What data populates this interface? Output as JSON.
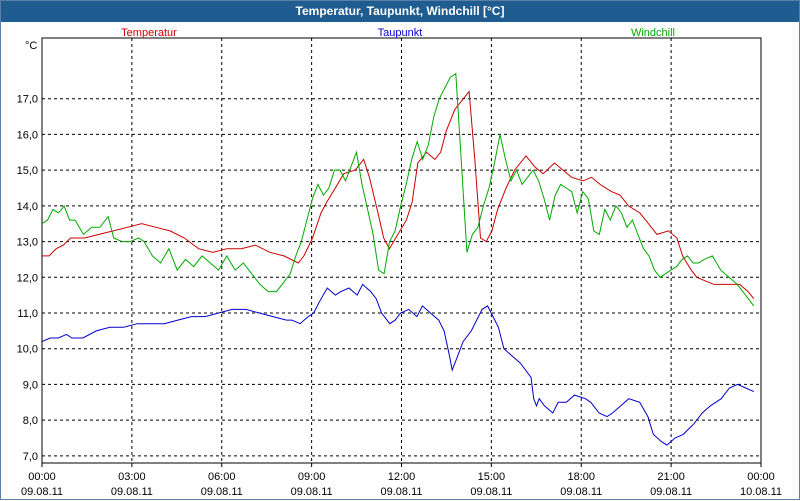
{
  "window": {
    "title": "Temperatur, Taupunkt, Windchill [°C]"
  },
  "chart_data": {
    "type": "line",
    "title": "Temperatur, Taupunkt, Windchill [°C]",
    "ylabel": "°C",
    "ylim": [
      6.8,
      18.7
    ],
    "yticks": [
      7.0,
      8.0,
      9.0,
      10.0,
      11.0,
      12.0,
      13.0,
      14.0,
      15.0,
      16.0,
      17.0
    ],
    "ytick_labels": [
      "7,0",
      "8,0",
      "9,0",
      "10,0",
      "11,0",
      "12,0",
      "13,0",
      "14,0",
      "15,0",
      "16,0",
      "17,0"
    ],
    "xlim": [
      0,
      24
    ],
    "xticks": [
      0,
      3,
      6,
      9,
      12,
      15,
      18,
      21,
      24
    ],
    "xtick_time_labels": [
      "00:00",
      "03:00",
      "06:00",
      "09:00",
      "12:00",
      "15:00",
      "18:00",
      "21:00",
      "00:00"
    ],
    "xtick_date_labels": [
      "09.08.11",
      "09.08.11",
      "09.08.11",
      "09.08.11",
      "09.08.11",
      "09.08.11",
      "09.08.11",
      "09.08.11",
      "10.08.11"
    ],
    "grid": true,
    "legend_placement": "top",
    "series": [
      {
        "name": "Temperatur",
        "color": "#cc0000",
        "points": [
          [
            0,
            12.6
          ],
          [
            0.25,
            12.6
          ],
          [
            0.5,
            12.8
          ],
          [
            0.75,
            12.9
          ],
          [
            1,
            13.1
          ],
          [
            1.5,
            13.1
          ],
          [
            2,
            13.2
          ],
          [
            2.5,
            13.3
          ],
          [
            3,
            13.4
          ],
          [
            3.5,
            13.5
          ],
          [
            4,
            13.4
          ],
          [
            4.5,
            13.3
          ],
          [
            5,
            13.1
          ],
          [
            5.5,
            12.8
          ],
          [
            6,
            12.7
          ],
          [
            6.5,
            12.8
          ],
          [
            7,
            12.8
          ],
          [
            7.5,
            12.9
          ],
          [
            8,
            12.7
          ],
          [
            8.5,
            12.6
          ],
          [
            9,
            12.4
          ],
          [
            9.2,
            12.6
          ],
          [
            9.5,
            13.1
          ],
          [
            9.8,
            13.8
          ],
          [
            10,
            14.1
          ],
          [
            10.3,
            14.5
          ],
          [
            10.6,
            14.9
          ],
          [
            11,
            15.0
          ],
          [
            11.3,
            15.3
          ],
          [
            11.5,
            14.8
          ],
          [
            11.8,
            13.8
          ],
          [
            12,
            13.1
          ],
          [
            12.2,
            12.8
          ],
          [
            12.5,
            13.2
          ],
          [
            12.8,
            13.6
          ],
          [
            13,
            14.1
          ],
          [
            13.2,
            15.2
          ],
          [
            13.5,
            15.5
          ],
          [
            13.8,
            15.3
          ],
          [
            14,
            15.5
          ],
          [
            14.2,
            16.1
          ],
          [
            14.5,
            16.7
          ],
          [
            14.8,
            17.0
          ],
          [
            15,
            17.2
          ],
          [
            15.2,
            15.3
          ],
          [
            15.4,
            13.1
          ],
          [
            15.6,
            13.0
          ],
          [
            15.8,
            13.3
          ],
          [
            16,
            13.9
          ],
          [
            16.3,
            14.5
          ],
          [
            16.6,
            15.0
          ],
          [
            17,
            15.4
          ],
          [
            17.3,
            15.1
          ],
          [
            17.6,
            14.9
          ],
          [
            18,
            15.2
          ],
          [
            18.3,
            15.0
          ],
          [
            18.6,
            14.8
          ],
          [
            19,
            14.7
          ],
          [
            19.3,
            14.8
          ],
          [
            19.6,
            14.6
          ],
          [
            20,
            14.4
          ],
          [
            20.3,
            14.3
          ],
          [
            20.6,
            14.0
          ],
          [
            21,
            13.8
          ],
          [
            21.3,
            13.5
          ],
          [
            21.6,
            13.2
          ],
          [
            22,
            13.3
          ],
          [
            22.3,
            13.1
          ],
          [
            22.5,
            12.6
          ],
          [
            22.8,
            12.2
          ],
          [
            23,
            12.0
          ],
          [
            23.3,
            11.9
          ],
          [
            23.6,
            11.8
          ],
          [
            24,
            11.8
          ],
          [
            24.5,
            11.8
          ],
          [
            24.8,
            11.6
          ],
          [
            25,
            11.4
          ]
        ]
      },
      {
        "name": "Taupunkt",
        "color": "#0000cc",
        "points": [
          [
            0,
            10.2
          ],
          [
            0.3,
            10.3
          ],
          [
            0.6,
            10.3
          ],
          [
            0.9,
            10.4
          ],
          [
            1.1,
            10.3
          ],
          [
            1.5,
            10.3
          ],
          [
            2,
            10.5
          ],
          [
            2.5,
            10.6
          ],
          [
            3,
            10.6
          ],
          [
            3.5,
            10.7
          ],
          [
            4,
            10.7
          ],
          [
            4.5,
            10.7
          ],
          [
            5,
            10.8
          ],
          [
            5.5,
            10.9
          ],
          [
            6,
            10.9
          ],
          [
            6.5,
            11.0
          ],
          [
            7,
            11.1
          ],
          [
            7.5,
            11.1
          ],
          [
            8,
            11.0
          ],
          [
            8.5,
            10.9
          ],
          [
            9,
            10.8
          ],
          [
            9.2,
            10.8
          ],
          [
            9.5,
            10.7
          ],
          [
            9.8,
            10.9
          ],
          [
            10,
            11.0
          ],
          [
            10.2,
            11.3
          ],
          [
            10.5,
            11.7
          ],
          [
            10.8,
            11.5
          ],
          [
            11,
            11.6
          ],
          [
            11.3,
            11.7
          ],
          [
            11.6,
            11.5
          ],
          [
            11.8,
            11.8
          ],
          [
            12.1,
            11.6
          ],
          [
            12.3,
            11.4
          ],
          [
            12.5,
            11.0
          ],
          [
            12.8,
            10.7
          ],
          [
            13,
            10.8
          ],
          [
            13.2,
            11.0
          ],
          [
            13.5,
            11.1
          ],
          [
            13.8,
            10.9
          ],
          [
            14,
            11.2
          ],
          [
            14.3,
            11.0
          ],
          [
            14.6,
            10.8
          ],
          [
            14.8,
            10.5
          ],
          [
            15,
            9.8
          ],
          [
            15.1,
            9.4
          ],
          [
            15.3,
            9.8
          ],
          [
            15.5,
            10.2
          ],
          [
            15.8,
            10.5
          ],
          [
            16,
            10.8
          ],
          [
            16.2,
            11.1
          ],
          [
            16.4,
            11.2
          ],
          [
            16.6,
            10.9
          ],
          [
            16.8,
            10.6
          ],
          [
            17,
            10.0
          ],
          [
            17.3,
            9.8
          ],
          [
            17.6,
            9.6
          ],
          [
            18,
            9.2
          ],
          [
            18.1,
            8.6
          ],
          [
            18.2,
            8.4
          ],
          [
            18.3,
            8.6
          ],
          [
            18.5,
            8.4
          ],
          [
            18.8,
            8.2
          ],
          [
            19,
            8.5
          ],
          [
            19.3,
            8.5
          ],
          [
            19.6,
            8.7
          ],
          [
            20,
            8.6
          ],
          [
            20.2,
            8.5
          ],
          [
            20.5,
            8.2
          ],
          [
            20.8,
            8.1
          ],
          [
            21,
            8.2
          ],
          [
            21.3,
            8.4
          ],
          [
            21.6,
            8.6
          ],
          [
            22,
            8.5
          ],
          [
            22.3,
            8.1
          ],
          [
            22.5,
            7.6
          ],
          [
            22.8,
            7.4
          ],
          [
            23,
            7.3
          ],
          [
            23.3,
            7.5
          ],
          [
            23.6,
            7.6
          ],
          [
            24,
            7.9
          ],
          [
            24.3,
            8.2
          ],
          [
            24.6,
            8.4
          ],
          [
            25,
            8.6
          ],
          [
            25.3,
            8.9
          ],
          [
            25.6,
            9.0
          ],
          [
            25.9,
            8.9
          ],
          [
            26.2,
            8.8
          ]
        ]
      },
      {
        "name": "Windchill",
        "color": "#00aa00",
        "points": [
          [
            0,
            13.5
          ],
          [
            0.2,
            13.6
          ],
          [
            0.4,
            13.9
          ],
          [
            0.6,
            13.8
          ],
          [
            0.8,
            14.0
          ],
          [
            1,
            13.6
          ],
          [
            1.2,
            13.6
          ],
          [
            1.5,
            13.2
          ],
          [
            1.8,
            13.4
          ],
          [
            2.1,
            13.4
          ],
          [
            2.4,
            13.7
          ],
          [
            2.6,
            13.1
          ],
          [
            2.9,
            13.0
          ],
          [
            3.2,
            13.0
          ],
          [
            3.5,
            13.1
          ],
          [
            3.7,
            13.0
          ],
          [
            4,
            12.6
          ],
          [
            4.3,
            12.4
          ],
          [
            4.6,
            12.8
          ],
          [
            4.9,
            12.2
          ],
          [
            5.2,
            12.5
          ],
          [
            5.5,
            12.3
          ],
          [
            5.8,
            12.6
          ],
          [
            6.1,
            12.4
          ],
          [
            6.4,
            12.2
          ],
          [
            6.7,
            12.6
          ],
          [
            7,
            12.2
          ],
          [
            7.3,
            12.4
          ],
          [
            7.6,
            12.1
          ],
          [
            7.9,
            11.8
          ],
          [
            8.2,
            11.6
          ],
          [
            8.5,
            11.6
          ],
          [
            8.8,
            11.9
          ],
          [
            9,
            12.1
          ],
          [
            9.2,
            12.6
          ],
          [
            9.4,
            13.0
          ],
          [
            9.6,
            13.6
          ],
          [
            9.8,
            14.2
          ],
          [
            10,
            14.6
          ],
          [
            10.2,
            14.3
          ],
          [
            10.4,
            14.5
          ],
          [
            10.6,
            15.0
          ],
          [
            10.8,
            15.0
          ],
          [
            11,
            14.7
          ],
          [
            11.2,
            15.1
          ],
          [
            11.4,
            15.5
          ],
          [
            11.6,
            14.6
          ],
          [
            11.8,
            13.9
          ],
          [
            12,
            13.2
          ],
          [
            12.2,
            12.2
          ],
          [
            12.4,
            12.1
          ],
          [
            12.6,
            13.0
          ],
          [
            12.8,
            13.3
          ],
          [
            13,
            14.0
          ],
          [
            13.2,
            14.6
          ],
          [
            13.4,
            15.3
          ],
          [
            13.6,
            15.8
          ],
          [
            13.8,
            15.3
          ],
          [
            14,
            15.7
          ],
          [
            14.2,
            16.5
          ],
          [
            14.4,
            17.0
          ],
          [
            14.6,
            17.3
          ],
          [
            14.8,
            17.6
          ],
          [
            15,
            17.7
          ],
          [
            15.2,
            15.2
          ],
          [
            15.4,
            12.7
          ],
          [
            15.6,
            13.2
          ],
          [
            15.8,
            13.4
          ],
          [
            16,
            14.0
          ],
          [
            16.2,
            14.5
          ],
          [
            16.4,
            15.2
          ],
          [
            16.6,
            16.0
          ],
          [
            16.8,
            15.3
          ],
          [
            17,
            14.7
          ],
          [
            17.2,
            15.0
          ],
          [
            17.4,
            14.6
          ],
          [
            17.6,
            14.8
          ],
          [
            17.8,
            15.0
          ],
          [
            18,
            14.7
          ],
          [
            18.2,
            14.2
          ],
          [
            18.4,
            13.6
          ],
          [
            18.6,
            14.3
          ],
          [
            18.8,
            14.6
          ],
          [
            19,
            14.5
          ],
          [
            19.2,
            14.4
          ],
          [
            19.4,
            13.8
          ],
          [
            19.6,
            14.4
          ],
          [
            19.8,
            14.2
          ],
          [
            20,
            13.3
          ],
          [
            20.2,
            13.2
          ],
          [
            20.4,
            13.9
          ],
          [
            20.6,
            13.6
          ],
          [
            20.8,
            14.0
          ],
          [
            21,
            13.8
          ],
          [
            21.2,
            13.4
          ],
          [
            21.4,
            13.6
          ],
          [
            21.6,
            13.2
          ],
          [
            21.8,
            12.8
          ],
          [
            22,
            12.6
          ],
          [
            22.2,
            12.2
          ],
          [
            22.4,
            12.0
          ],
          [
            22.6,
            12.1
          ],
          [
            22.8,
            12.2
          ],
          [
            23,
            12.3
          ],
          [
            23.2,
            12.5
          ],
          [
            23.4,
            12.6
          ],
          [
            23.6,
            12.4
          ],
          [
            23.8,
            12.4
          ],
          [
            24,
            12.5
          ],
          [
            24.3,
            12.6
          ],
          [
            24.6,
            12.2
          ],
          [
            24.9,
            12.0
          ],
          [
            25.2,
            11.8
          ],
          [
            25.5,
            11.5
          ],
          [
            25.8,
            11.2
          ]
        ]
      }
    ]
  }
}
